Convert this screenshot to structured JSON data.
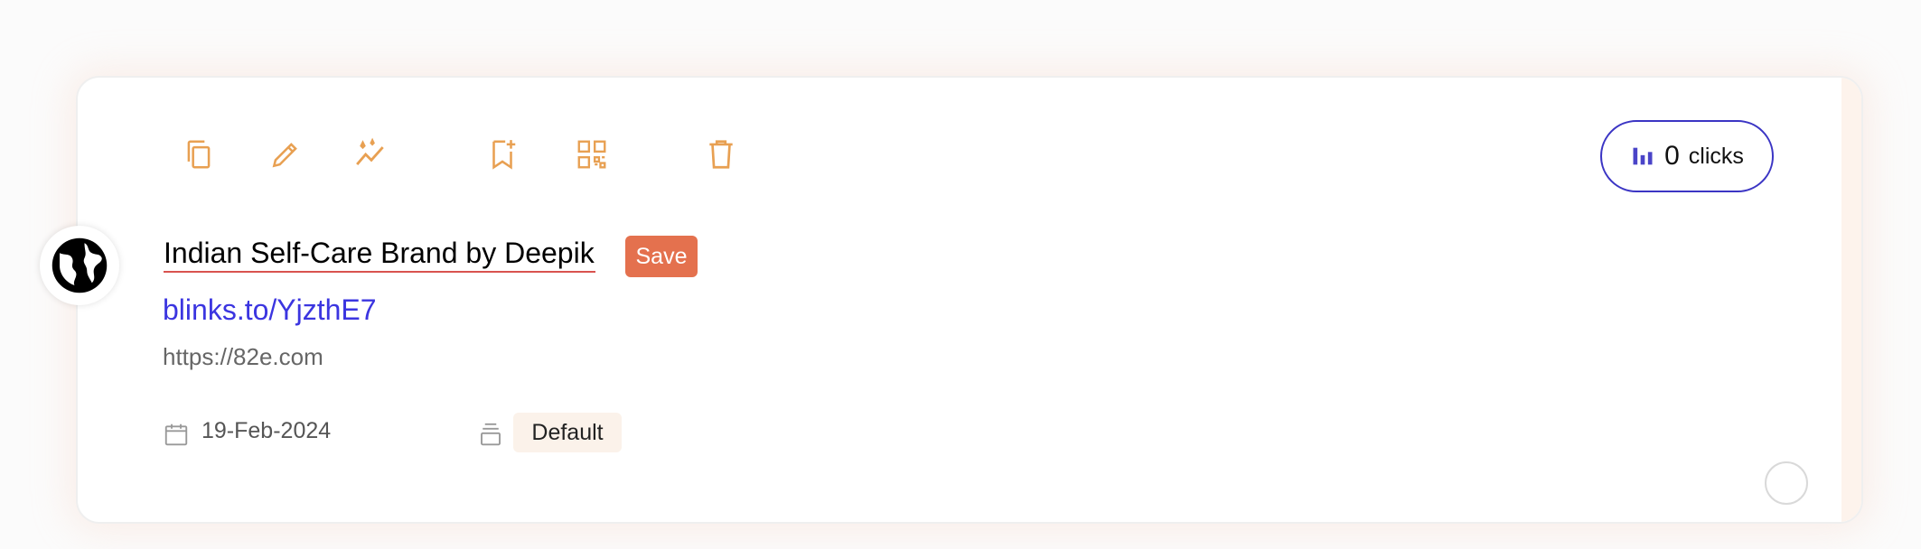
{
  "toolbar": {
    "icons": [
      "copy-icon",
      "edit-icon",
      "analytics-icon",
      "bookmark-icon",
      "qr-code-icon",
      "delete-icon"
    ],
    "accent_color": "#e8a052"
  },
  "clicks": {
    "count": "0",
    "label": "clicks",
    "border_color": "#3b35c4",
    "icon": "bar-chart-icon"
  },
  "link": {
    "favicon": "globe-icon",
    "title_value": "Indian Self-Care Brand by Deepik",
    "save_label": "Save",
    "short_url": "blinks.to/YjzthE7",
    "destination": "https://82e.com",
    "created_date": "19-Feb-2024",
    "group_tag": "Default"
  },
  "colors": {
    "save_button": "#e4714e",
    "short_link": "#3b35e0"
  }
}
